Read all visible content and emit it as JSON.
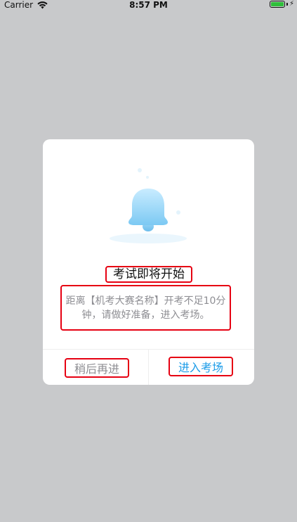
{
  "status_bar": {
    "carrier": "Carrier",
    "time": "8:57 PM",
    "battery_level": 1.0,
    "battery_color": "#2fbf3b",
    "icons": [
      "wifi-icon",
      "battery-icon",
      "charging-bolt-icon"
    ]
  },
  "dialog": {
    "illustration_icon": "bell-icon",
    "title": "考试即将开始",
    "message": "距离【机考大赛名称】开考不足10分钟，请做好准备，进入考场。",
    "buttons": {
      "later_label": "稍后再进",
      "enter_label": "进入考场"
    }
  },
  "colors": {
    "overlay": "#c8c9cb",
    "accent": "#1a9be8",
    "secondary_text": "#8e8e93",
    "highlight_border": "#e60012"
  }
}
